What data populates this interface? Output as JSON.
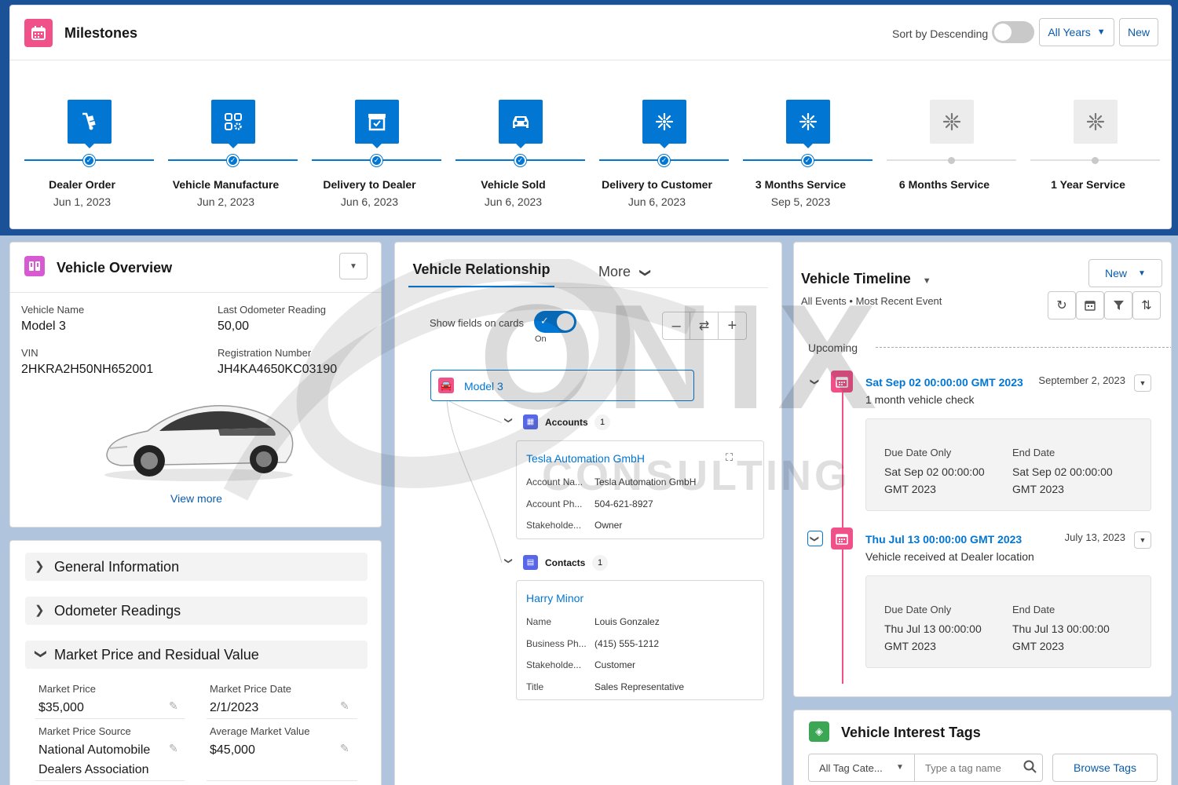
{
  "milestones": {
    "title": "Milestones",
    "sort_label": "Sort by Descending",
    "years_button": "All Years",
    "new_button": "New",
    "accent_blue": "#0176d3",
    "icon_pink": "#f05189",
    "steps": [
      {
        "label": "Dealer Order",
        "date": "Jun 1, 2023",
        "icon": "dolly-icon",
        "done": true
      },
      {
        "label": "Vehicle Manufacture",
        "date": "Jun 2, 2023",
        "icon": "apps-gear-icon",
        "done": true
      },
      {
        "label": "Delivery to Dealer",
        "date": "Jun 6, 2023",
        "icon": "archive-icon",
        "done": true
      },
      {
        "label": "Vehicle Sold",
        "date": "Jun 6, 2023",
        "icon": "car-icon",
        "done": true
      },
      {
        "label": "Delivery to Customer",
        "date": "Jun 6, 2023",
        "icon": "sparkle-icon",
        "done": true
      },
      {
        "label": "3 Months Service",
        "date": "Sep 5, 2023",
        "icon": "sparkle-icon",
        "done": true
      },
      {
        "label": "6 Months Service",
        "date": "",
        "icon": "sparkle-icon",
        "done": false
      },
      {
        "label": "1 Year Service",
        "date": "",
        "icon": "sparkle-icon",
        "done": false
      }
    ]
  },
  "overview": {
    "title": "Vehicle Overview",
    "fields": {
      "vehicle_name_label": "Vehicle Name",
      "vehicle_name": "Model 3",
      "odometer_label": "Last Odometer Reading",
      "odometer": "50,00",
      "vin_label": "VIN",
      "vin": "2HKRA2H50NH652001",
      "reg_label": "Registration Number",
      "reg": "JH4KA4650KC03190"
    },
    "view_more": "View more"
  },
  "accordion": {
    "sections": [
      "General Information",
      "Odometer Readings",
      "Market Price and Residual Value"
    ],
    "market": {
      "price_label": "Market Price",
      "price": "$35,000",
      "price_date_label": "Market Price Date",
      "price_date": "2/1/2023",
      "source_label": "Market Price Source",
      "source_line1": "National Automobile",
      "source_line2": "Dealers Association",
      "avg_label": "Average Market Value",
      "avg": "$45,000"
    }
  },
  "relationship": {
    "tab_active": "Vehicle Relationship",
    "tab_more": "More",
    "show_fields_label": "Show fields on cards",
    "toggle_state": "On",
    "root_node": "Model 3",
    "accounts": {
      "label": "Accounts",
      "count": "1",
      "card_title": "Tesla Automation GmbH",
      "rows": [
        {
          "k": "Account Na...",
          "v": "Tesla Automation GmbH"
        },
        {
          "k": "Account Ph...",
          "v": "504-621-8927"
        },
        {
          "k": "Stakeholde...",
          "v": "Owner"
        }
      ]
    },
    "contacts": {
      "label": "Contacts",
      "count": "1",
      "card_title": "Harry Minor",
      "rows": [
        {
          "k": "Name",
          "v": "Louis Gonzalez"
        },
        {
          "k": "Business Ph...",
          "v": "(415) 555-1212"
        },
        {
          "k": "Stakeholde...",
          "v": "Customer"
        },
        {
          "k": "Title",
          "v": "Sales Representative"
        }
      ]
    }
  },
  "timeline": {
    "title": "Vehicle Timeline",
    "subtitle": "All Events • Most Recent Event",
    "new_button": "New",
    "upcoming": "Upcoming",
    "events": [
      {
        "title": "Sat Sep 02 00:00:00 GMT 2023",
        "date": "September 2, 2023",
        "desc": "1 month vehicle check",
        "due_label": "Due Date Only",
        "due_line1": "Sat Sep 02 00:00:00",
        "due_line2": "GMT 2023",
        "end_label": "End Date",
        "end_line1": "Sat Sep 02 00:00:00",
        "end_line2": "GMT 2023"
      },
      {
        "title": "Thu Jul 13 00:00:00 GMT 2023",
        "date": "July 13, 2023",
        "desc": "Vehicle received at Dealer location",
        "due_label": "Due Date Only",
        "due_line1": "Thu Jul 13 00:00:00",
        "due_line2": "GMT 2023",
        "end_label": "End Date",
        "end_line1": "Thu Jul 13 00:00:00",
        "end_line2": "GMT 2023"
      }
    ]
  },
  "tags": {
    "title": "Vehicle Interest Tags",
    "category_select": "All Tag Cate...",
    "search_placeholder": "Type a tag name",
    "browse_button": "Browse Tags"
  },
  "watermark": {
    "line1": "ONIX",
    "line2": "CONSULTING"
  }
}
